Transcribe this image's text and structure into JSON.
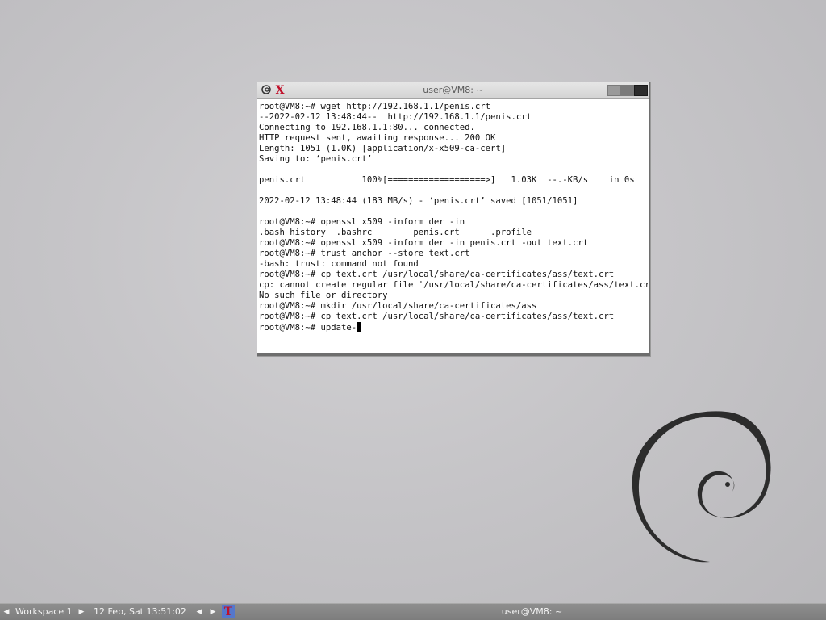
{
  "window": {
    "title": "user@VM8: ~",
    "menu_icon": "debian-swirl-menu-icon",
    "app_icon": "x-terminal-icon",
    "app_glyph": "X",
    "minimize_icon": "minimize-icon",
    "maximize_icon": "maximize-icon",
    "close_icon": "close-icon"
  },
  "terminal": {
    "lines": [
      "root@VM8:~# wget http://192.168.1.1/penis.crt",
      "--2022-02-12 13:48:44--  http://192.168.1.1/penis.crt",
      "Connecting to 192.168.1.1:80... connected.",
      "HTTP request sent, awaiting response... 200 OK",
      "Length: 1051 (1.0K) [application/x-x509-ca-cert]",
      "Saving to: ‘penis.crt’",
      "",
      "penis.crt           100%[===================>]   1.03K  --.-KB/s    in 0s",
      "",
      "2022-02-12 13:48:44 (183 MB/s) - ‘penis.crt’ saved [1051/1051]",
      "",
      "root@VM8:~# openssl x509 -inform der -in",
      ".bash_history  .bashrc        penis.crt      .profile",
      "root@VM8:~# openssl x509 -inform der -in penis.crt -out text.crt",
      "root@VM8:~# trust anchor --store text.crt",
      "-bash: trust: command not found",
      "root@VM8:~# cp text.crt /usr/local/share/ca-certificates/ass/text.crt",
      "cp: cannot create regular file '/usr/local/share/ca-certificates/ass/text.crt':",
      "No such file or directory",
      "root@VM8:~# mkdir /usr/local/share/ca-certificates/ass",
      "root@VM8:~# cp text.crt /usr/local/share/ca-certificates/ass/text.crt"
    ],
    "prompt_line": "root@VM8:~# update-"
  },
  "taskbar": {
    "prev_workspace_arrow": "◀",
    "workspace": "Workspace 1",
    "next_workspace_arrow": "▶",
    "datetime": "12 Feb, Sat 13:51:02",
    "prev_task_arrow": "◀",
    "next_task_arrow": "▶",
    "task_icon": "x-terminal-icon",
    "task_glyph": "T",
    "task_title": "user@VM8: ~"
  },
  "desktop": {
    "logo": "debian-swirl-logo"
  }
}
